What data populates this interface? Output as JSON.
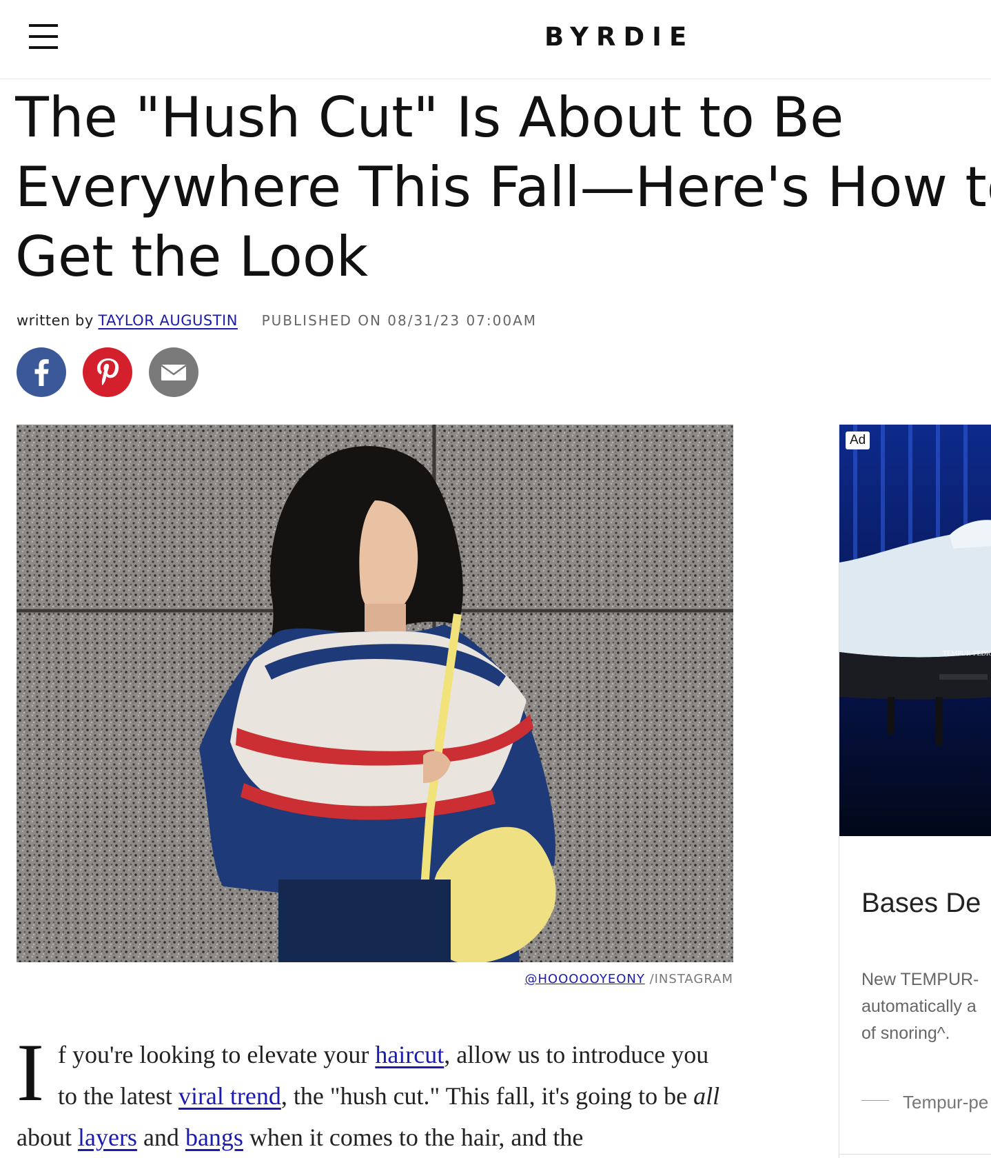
{
  "header": {
    "logo": "BYRDIE",
    "menu_icon": "hamburger-menu-icon"
  },
  "article": {
    "title_lines": [
      "The \"Hush Cut\" Is About to Be",
      "Everywhere This Fall—Here's How to",
      "Get the Look"
    ],
    "byline": {
      "written_by": "written by",
      "author": "TAYLOR AUGUSTIN",
      "published": "PUBLISHED ON 08/31/23 07:00AM"
    },
    "share": {
      "facebook_icon": "facebook-icon",
      "pinterest_icon": "pinterest-icon",
      "email_icon": "email-icon"
    },
    "hero": {
      "caption_handle": "@HOOOOOYEONY",
      "caption_source": "/INSTAGRAM"
    },
    "body": {
      "dropcap": "I",
      "p1": "f you're looking to elevate your ",
      "link_haircut": "haircut",
      "p2": ", allow us to introduce you to the latest ",
      "link_viral_trend": "viral trend",
      "p3": ", the \"hush cut.\" This fall, it's going to be ",
      "em_all": "all",
      "p4": " about ",
      "link_layers": "layers",
      "p5": " and ",
      "link_bangs": "bangs",
      "p6": " when it comes to the hair, and the"
    }
  },
  "ad": {
    "badge": "Ad",
    "headline": "Bases De",
    "description": "New TEMPUR-\nautomatically a\nof snoring^.",
    "sponsor": "Tempur-pe",
    "product_label": "TEMPUR-PEDIC"
  },
  "colors": {
    "link": "#1b1bb0",
    "facebook": "#3b5998",
    "pinterest": "#d3202c",
    "email": "#7a7a7a",
    "ad_bg": "#0a1a5a"
  }
}
